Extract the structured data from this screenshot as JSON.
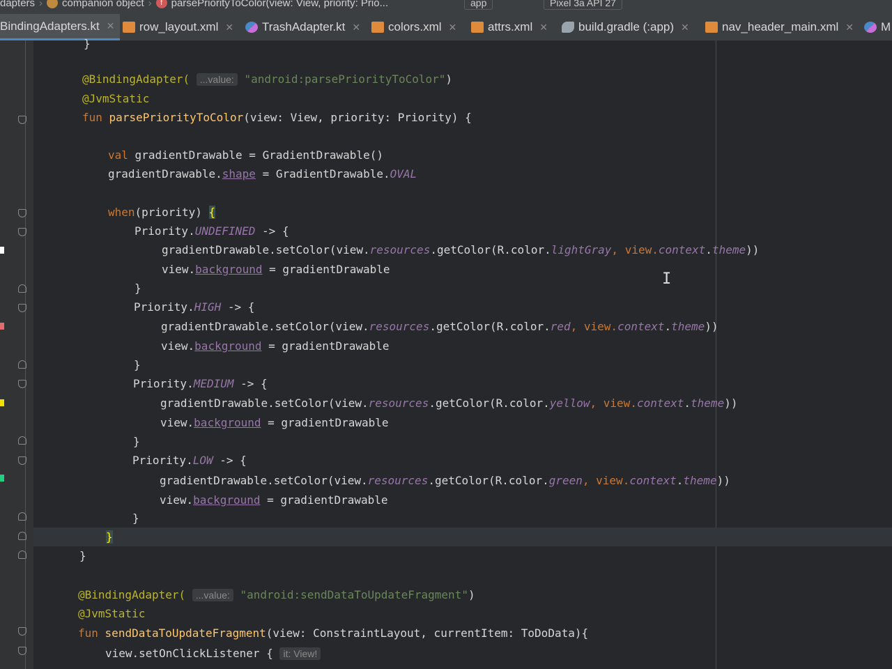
{
  "breadcrumb": {
    "item1": "dapters",
    "item2": "companion object",
    "item3": "parsePriorityToColor(view: View, priority: Prio..."
  },
  "toolbar": {
    "run_config": "app",
    "device": "Pixel 3a API 27"
  },
  "tabs": [
    {
      "label": "BindingAdapters.kt",
      "type": "kt",
      "active": true
    },
    {
      "label": "row_layout.xml",
      "type": "xml",
      "active": false
    },
    {
      "label": "TrashAdapter.kt",
      "type": "kt",
      "active": false
    },
    {
      "label": "colors.xml",
      "type": "xml",
      "active": false
    },
    {
      "label": "attrs.xml",
      "type": "xml",
      "active": false
    },
    {
      "label": "build.gradle (:app)",
      "type": "gradle",
      "active": false
    },
    {
      "label": "nav_header_main.xml",
      "type": "xml",
      "active": false
    },
    {
      "label": "M",
      "type": "kt",
      "active": false
    }
  ],
  "code": {
    "l0": "}",
    "l1_ann": "@BindingAdapter(",
    "l1_hint": "...value:",
    "l1_str": "\"android:parsePriorityToColor\"",
    "l1_end": ")",
    "l2": "@JvmStatic",
    "l3_kw": "fun",
    "l3_fn": "parsePriorityToColor",
    "l3_rest": "(view: View, priority: Priority) {",
    "l4_kw": "val",
    "l4_rest": "gradientDrawable = GradientDrawable()",
    "l5_a": "gradientDrawable.",
    "l5_prop": "shape",
    "l5_b": " = GradientDrawable.",
    "l5_const": "OVAL",
    "l6_kw": "when",
    "l6_rest": "(priority) ",
    "l6_brace": "{",
    "undefined_a": "Priority.",
    "undefined_c": "UNDEFINED",
    "undefined_b": " -> {",
    "set_a": "gradientDrawable.setColor(view.",
    "resources": "resources",
    "set_b": ".getColor(R.color.",
    "color_lightgray": "lightGray",
    "set_c": ", view.",
    "context": "context",
    "dot": ".",
    "theme": "theme",
    "set_d": "))",
    "bg_a": "view.",
    "bg_prop": "background",
    "bg_b": " = gradientDrawable",
    "close": "}",
    "high_c": "HIGH",
    "color_red": "red",
    "medium_c": "MEDIUM",
    "color_yellow": "yellow",
    "low_c": "LOW",
    "color_green": "green",
    "when_close": "}",
    "fun_close": "}",
    "l2_ann": "@BindingAdapter(",
    "l2_hint": "...value:",
    "l2_str": "\"android:sendDataToUpdateFragment\"",
    "l2_end": ")",
    "l2_jvm": "@JvmStatic",
    "l2_kw": "fun",
    "l2_fn": "sendDataToUpdateFragment",
    "l2_rest": "(view: ConstraintLayout, currentItem: ToDoData){",
    "l2_click": "view.setOnClickListener {",
    "l2_click_hint": "it: View!"
  },
  "colors": {
    "keyword": "#cc7832",
    "annotation": "#bbb529",
    "function": "#ffc66d",
    "string": "#6a8759",
    "constant": "#9876aa",
    "accent_tab": "#4a88c7"
  }
}
